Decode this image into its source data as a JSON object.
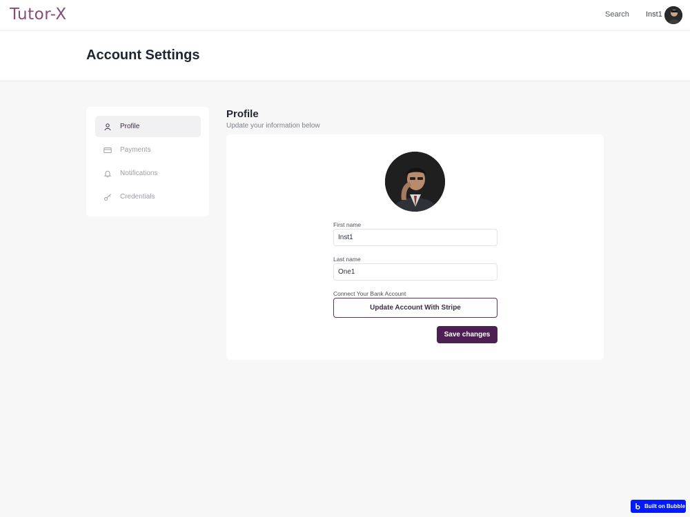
{
  "nav": {
    "logo": "Tutor-X",
    "search_label": "Search",
    "user_name": "Inst1"
  },
  "header": {
    "title": "Account Settings"
  },
  "sidebar": {
    "items": [
      {
        "label": "Profile",
        "icon": "user-icon",
        "active": true
      },
      {
        "label": "Payments",
        "icon": "credit-card-icon",
        "active": false
      },
      {
        "label": "Notifications",
        "icon": "bell-icon",
        "active": false
      },
      {
        "label": "Credentials",
        "icon": "key-icon",
        "active": false
      }
    ]
  },
  "profile": {
    "title": "Profile",
    "subtitle": "Update your information below",
    "first_name_label": "First name",
    "first_name_value": "Inst1",
    "last_name_label": "Last name",
    "last_name_value": "One1",
    "bank_label": "Connect Your Bank Account",
    "stripe_button": "Update Account With Stripe",
    "save_button": "Save changes"
  },
  "badge": {
    "label": "Built on Bubble"
  },
  "colors": {
    "brand": "#8a4a7a",
    "primary_button": "#4e1f52",
    "badge_blue": "#0019ff"
  }
}
